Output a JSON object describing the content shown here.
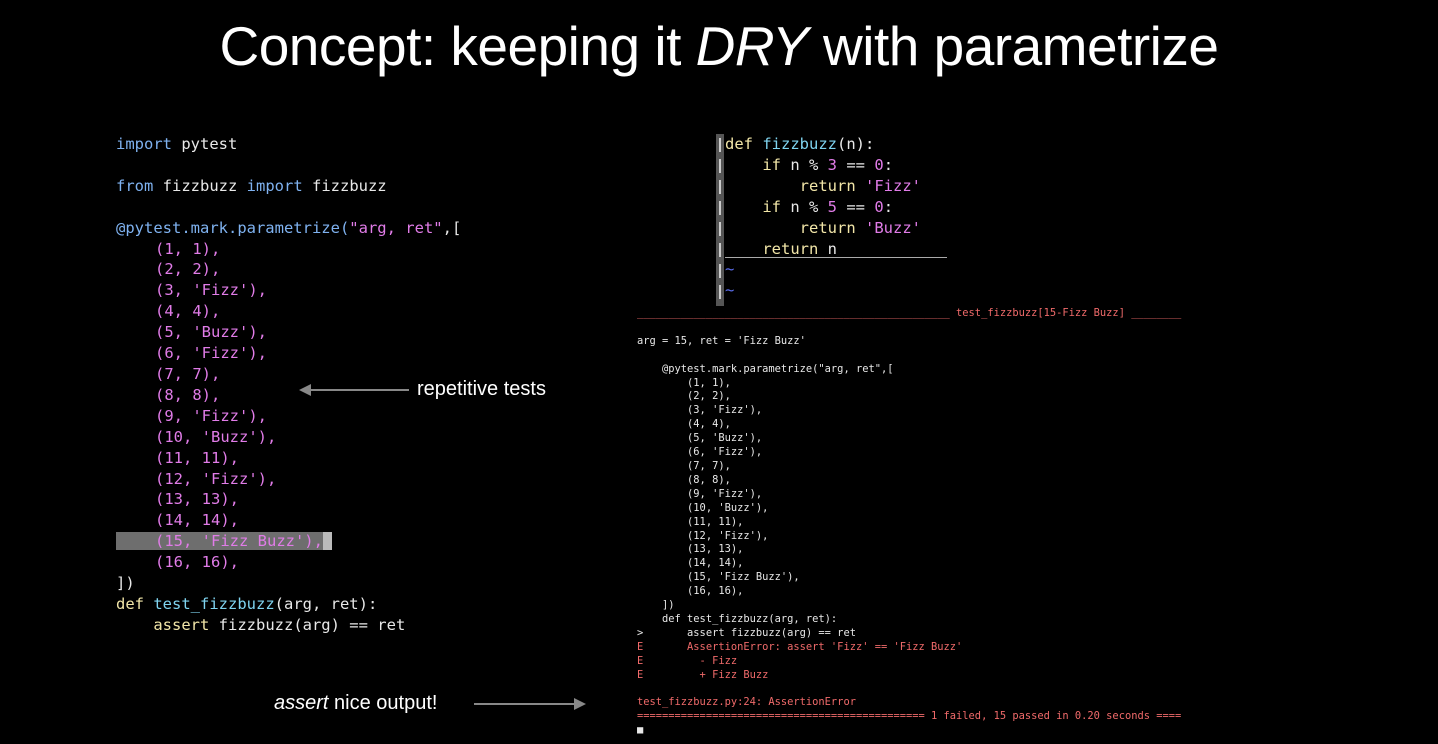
{
  "slide": {
    "title_prefix": "Concept: keeping it ",
    "title_emph": "DRY",
    "title_suffix": " with parametrize"
  },
  "left_code": {
    "import_kw": "import",
    "import_mod": " pytest",
    "from_kw": "from",
    "from_mod": " fizzbuzz ",
    "from_import_kw": "import",
    "from_name": " fizzbuzz",
    "decorator": "@pytest.mark.parametrize(",
    "decorator_args": "\"arg, ret\"",
    "decorator_tail": ",[",
    "params": [
      "(1, 1),",
      "(2, 2),",
      "(3, 'Fizz'),",
      "(4, 4),",
      "(5, 'Buzz'),",
      "(6, 'Fizz'),",
      "(7, 7),",
      "(8, 8),",
      "(9, 'Fizz'),",
      "(10, 'Buzz'),",
      "(11, 11),",
      "(12, 'Fizz'),",
      "(13, 13),",
      "(14, 14),",
      "(15, 'Fizz Buzz'),",
      "(16, 16),"
    ],
    "close": "])",
    "def_kw": "def",
    "def_name": " test_fizzbuzz",
    "def_args": "(arg, ret):",
    "assert_kw": "    assert",
    "assert_expr": " fizzbuzz(arg) == ret"
  },
  "annotations": {
    "repetitive": "repetitive tests",
    "assert_italic": "assert",
    "assert_rest": " nice output!"
  },
  "vim": {
    "lines": [
      {
        "kw": "def",
        "rest": " ",
        "fn": "fizzbuzz",
        "tail": "(n):"
      },
      {
        "indent": "    ",
        "kw": "if",
        "rest": " n % ",
        "num": "3",
        "tail2": " == ",
        "num2": "0",
        "end": ":"
      },
      {
        "indent": "        ",
        "kw": "return",
        "str": " 'Fizz'"
      },
      {
        "indent": "    ",
        "kw": "if",
        "rest": " n % ",
        "num": "5",
        "tail2": " == ",
        "num2": "0",
        "end": ":"
      },
      {
        "indent": "        ",
        "kw": "return",
        "str": " 'Buzz'"
      },
      {
        "indent": "    ",
        "kw": "return",
        "rest": " n"
      }
    ],
    "tilde": "~"
  },
  "terminal": {
    "header_rule": "__________________________________________________ test_fizzbuzz[15-Fizz Buzz] ________",
    "arg_line": "arg = 15, ret = 'Fizz Buzz'",
    "decorator": "    @pytest.mark.parametrize(\"arg, ret\",[",
    "params": [
      "        (1, 1),",
      "        (2, 2),",
      "        (3, 'Fizz'),",
      "        (4, 4),",
      "        (5, 'Buzz'),",
      "        (6, 'Fizz'),",
      "        (7, 7),",
      "        (8, 8),",
      "        (9, 'Fizz'),",
      "        (10, 'Buzz'),",
      "        (11, 11),",
      "        (12, 'Fizz'),",
      "        (13, 13),",
      "        (14, 14),",
      "        (15, 'Fizz Buzz'),",
      "        (16, 16),"
    ],
    "close": "    ])",
    "def_line": "    def test_fizzbuzz(arg, ret):",
    "assert_line": ">       assert fizzbuzz(arg) == ret",
    "err1": "E       AssertionError: assert 'Fizz' == 'Fizz Buzz'",
    "err2": "E         - Fizz",
    "err3": "E         + Fizz Buzz",
    "location": "test_fizzbuzz.py:24: AssertionError",
    "summary": "============================================== 1 failed, 15 passed in 0.20 seconds ====",
    "prompt_cursor": "■"
  }
}
